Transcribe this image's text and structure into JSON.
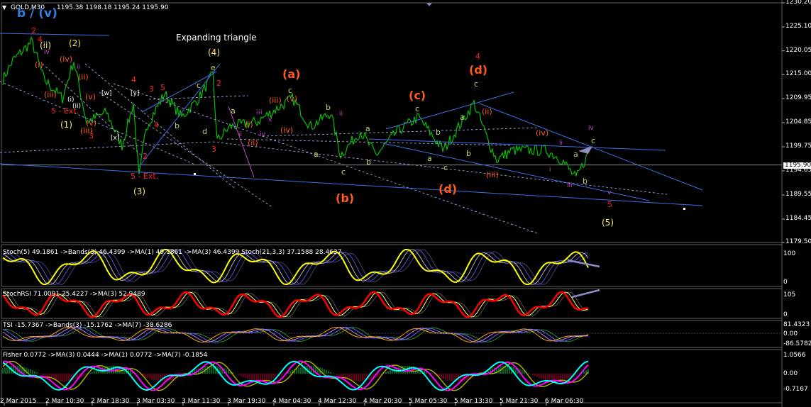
{
  "header": {
    "symbol": "GOLD,M30",
    "ohlc": "1195.38 1198.18 1195.24 1195.90",
    "corner_label": "b / (v)"
  },
  "colors": {
    "background": "#000000",
    "price_line": "#00c000",
    "trend_line": "#3b6ee8",
    "label_red": "#ff2020",
    "label_orange": "#ff5a1a",
    "label_yellow": "#f5e66a",
    "label_green": "#b5d86a",
    "label_magenta": "#d040d0",
    "wave_white": "#ffffff",
    "stoch_yellow": "#ffff00",
    "stochrsi_red": "#ff0000",
    "fisher_cyan": "#00ffff",
    "fisher_magenta": "#ff00ff"
  },
  "main_chart": {
    "title": "Expanding triangle",
    "current_price_label": "1195.90",
    "price_ticks": [
      "1230.20",
      "1225.10",
      "1220.05",
      "1215.00",
      "1209.95",
      "1204.85",
      "1199.75",
      "1194.65",
      "1189.55",
      "1184.45",
      "1179.50"
    ],
    "time_ticks": [
      "2 Mar 2015",
      "2 Mar 10:30",
      "2 Mar 18:30",
      "3 Mar 03:30",
      "3 Mar 11:30",
      "3 Mar 19:30",
      "4 Mar 04:30",
      "4 Mar 12:30",
      "4 Mar 20:30",
      "5 Mar 05:30",
      "5 Mar 13:30",
      "5 Mar 21:30",
      "6 Mar 06:30"
    ],
    "wave_labels": [
      {
        "text": "2",
        "color": "red"
      },
      {
        "text": "4",
        "color": "red"
      },
      {
        "text": "(ii)",
        "color": "yellow"
      },
      {
        "text": "(2)",
        "color": "yellow"
      },
      {
        "text": "iv",
        "color": "magenta"
      },
      {
        "text": "(iv)",
        "color": "orange"
      },
      {
        "text": "ii",
        "color": "magenta"
      },
      {
        "text": "(i)",
        "color": "orange"
      },
      {
        "text": "(ii)",
        "color": "orange"
      },
      {
        "text": "(iii)",
        "color": "orange"
      },
      {
        "text": "(v)",
        "color": "orange"
      },
      {
        "text": "(i)",
        "color": "white"
      },
      {
        "text": "(ii)",
        "color": "white"
      },
      {
        "text": "5 - Ext.",
        "color": "red"
      },
      {
        "text": "(1)",
        "color": "yellow"
      },
      {
        "text": "(iii)",
        "color": "orange"
      },
      {
        "text": "(v)",
        "color": "orange"
      },
      {
        "text": "3",
        "color": "red"
      },
      {
        "text": "[w]",
        "color": "white"
      },
      {
        "text": "[y]",
        "color": "white"
      },
      {
        "text": "[x]",
        "color": "white"
      },
      {
        "text": "4",
        "color": "red"
      },
      {
        "text": "3",
        "color": "red"
      },
      {
        "text": "5",
        "color": "red"
      },
      {
        "text": "4",
        "color": "red"
      },
      {
        "text": "2",
        "color": "red"
      },
      {
        "text": "5 - Ext.",
        "color": "red"
      },
      {
        "text": "(3)",
        "color": "yellow"
      },
      {
        "text": "b",
        "color": "green"
      },
      {
        "text": "(4)",
        "color": "yellow"
      },
      {
        "text": "e",
        "color": "green"
      },
      {
        "text": "c",
        "color": "green"
      },
      {
        "text": "2",
        "color": "red"
      },
      {
        "text": "a",
        "color": "green"
      },
      {
        "text": "d",
        "color": "green"
      },
      {
        "text": "3",
        "color": "red"
      },
      {
        "text": "(a)",
        "color": "orange"
      },
      {
        "text": "c",
        "color": "green"
      },
      {
        "text": "(v)",
        "color": "orange"
      },
      {
        "text": "(iii)",
        "color": "orange"
      },
      {
        "text": "iii",
        "color": "magenta"
      },
      {
        "text": "v",
        "color": "magenta"
      },
      {
        "text": "(i)",
        "color": "orange"
      },
      {
        "text": "(iv)",
        "color": "orange"
      },
      {
        "text": "(ii)",
        "color": "orange"
      },
      {
        "text": "iv",
        "color": "magenta"
      },
      {
        "text": "ii",
        "color": "magenta"
      },
      {
        "text": "b",
        "color": "green"
      },
      {
        "text": "a",
        "color": "green"
      },
      {
        "text": "ii",
        "color": "magenta"
      },
      {
        "text": "c",
        "color": "green"
      },
      {
        "text": "a",
        "color": "green"
      },
      {
        "text": "(b)",
        "color": "orange"
      },
      {
        "text": "b",
        "color": "green"
      },
      {
        "text": "(c)",
        "color": "orange"
      },
      {
        "text": "c",
        "color": "green"
      },
      {
        "text": "b",
        "color": "green"
      },
      {
        "text": "a",
        "color": "green"
      },
      {
        "text": "c",
        "color": "green"
      },
      {
        "text": "(d)",
        "color": "orange"
      },
      {
        "text": "4",
        "color": "red"
      },
      {
        "text": "(d)",
        "color": "orange"
      },
      {
        "text": "c",
        "color": "green"
      },
      {
        "text": "a",
        "color": "green"
      },
      {
        "text": "b",
        "color": "green"
      },
      {
        "text": "(ii)",
        "color": "orange"
      },
      {
        "text": "(iii)",
        "color": "orange"
      },
      {
        "text": "(iv)",
        "color": "orange"
      },
      {
        "text": "ii",
        "color": "magenta"
      },
      {
        "text": "i",
        "color": "magenta"
      },
      {
        "text": "iii",
        "color": "magenta"
      },
      {
        "text": "a",
        "color": "green"
      },
      {
        "text": "b",
        "color": "green"
      },
      {
        "text": "iv",
        "color": "magenta"
      },
      {
        "text": "c",
        "color": "green"
      },
      {
        "text": "v",
        "color": "magenta"
      },
      {
        "text": "5",
        "color": "red"
      },
      {
        "text": "(5)",
        "color": "yellow"
      }
    ]
  },
  "indicators": [
    {
      "name": "stoch",
      "label": "Stoch(5) 49.1861 ->Bands(3) 46.4399 ->MA(1) 49.1861 ->MA(3) 46.4399 Stoch(21,3,3) 37.1588 28.4637",
      "axis": [
        "100",
        "0"
      ]
    },
    {
      "name": "stochrsi",
      "label": "StochRSI 71.0091 25.4227 ->MA(3) 52.9489",
      "axis": [
        "105",
        "0"
      ]
    },
    {
      "name": "tsi",
      "label": "TSI -15.7367 ->Bands(3) -15.1762 ->MA(7) -38.6286",
      "axis": [
        "81.4323",
        "0.00",
        "-86.5782"
      ]
    },
    {
      "name": "fisher",
      "label": "Fisher 0.0772 ->MA(3) 0.0444 ->MA(1) 0.0772 ->MA(7) -0.1854",
      "axis": [
        "1.0566",
        "0.00",
        "-0.7167"
      ]
    }
  ],
  "chart_data": {
    "type": "line",
    "title": "GOLD,M30",
    "xlabel": "",
    "ylabel": "",
    "ylim": [
      1179.5,
      1230.2
    ],
    "grid": false,
    "x": [
      "2 Mar 2015",
      "2 Mar 10:30",
      "2 Mar 18:30",
      "3 Mar 03:30",
      "3 Mar 11:30",
      "3 Mar 19:30",
      "4 Mar 04:30",
      "4 Mar 12:30",
      "4 Mar 20:30",
      "5 Mar 05:30",
      "5 Mar 13:30",
      "5 Mar 21:30",
      "6 Mar 06:30"
    ],
    "series": [
      {
        "name": "GOLD,M30",
        "values": [
          1213.0,
          1216.5,
          1207.0,
          1201.0,
          1204.0,
          1205.0,
          1208.5,
          1200.0,
          1202.0,
          1206.0,
          1209.5,
          1201.0,
          1195.9
        ]
      }
    ]
  }
}
